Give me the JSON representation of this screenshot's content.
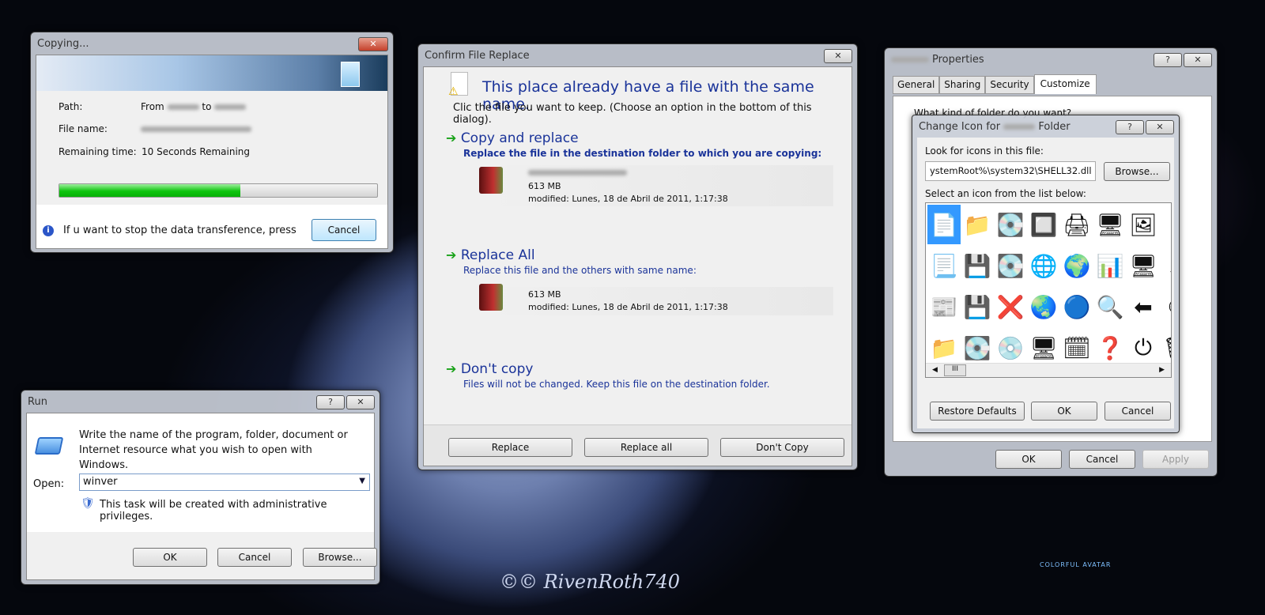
{
  "copying": {
    "title": "Copying...",
    "path_label": "Path:",
    "path_from": "From",
    "path_to": "to",
    "file_label": "File name:",
    "time_label": "Remaining time:",
    "time_value": "10 Seconds Remaining",
    "progress_percent": 57,
    "footer_text": "If u want to stop the data transference, press",
    "cancel": "Cancel"
  },
  "run": {
    "title": "Run",
    "help": "?",
    "description": "Write the name of the program, folder, document or Internet resource what you wish to open with Windows.",
    "open_label": "Open:",
    "open_value": "winver",
    "admin_note": "This task will be created with administrative privileges.",
    "ok": "OK",
    "cancel": "Cancel",
    "browse": "Browse..."
  },
  "replace": {
    "title": "Confirm File Replace",
    "heading": "This place already have a file with the same name.",
    "subheading": "Clic the file you want to keep. (Choose an option in the bottom of this dialog).",
    "options": [
      {
        "title": "Copy and replace",
        "desc": "Replace the file in the destination folder to which you are copying:",
        "size": "613 MB",
        "modified": "modified: Lunes, 18 de Abril de 2011, 1:17:38"
      },
      {
        "title": "Replace All",
        "desc": "Replace this file and the others with same name:",
        "size": "613 MB",
        "modified": "modified: Lunes, 18 de Abril de 2011, 1:17:38"
      },
      {
        "title": "Don't copy",
        "desc": "Files will not be changed. Keep this file on the destination folder."
      }
    ],
    "buttons": {
      "replace": "Replace",
      "replace_all": "Replace all",
      "dont_copy": "Don't Copy"
    }
  },
  "properties": {
    "title": "Properties",
    "help": "?",
    "tabs": [
      "General",
      "Sharing",
      "Security",
      "Customize"
    ],
    "active_tab": "Customize",
    "question": "What kind of folder do you want?",
    "ok": "OK",
    "cancel": "Cancel",
    "apply": "Apply"
  },
  "change_icon": {
    "title_prefix": "Change Icon for",
    "title_suffix": "Folder",
    "help": "?",
    "look_label": "Look for icons in this file:",
    "file_value": "ystemRoot%\\system32\\SHELL32.dll",
    "browse": "Browse...",
    "select_label": "Select an icon from the list below:",
    "restore": "Restore Defaults",
    "ok": "OK",
    "cancel": "Cancel",
    "icons": [
      "📄",
      "📁",
      "💽",
      "🔲",
      "🖨",
      "🖥",
      "🖼",
      "▪",
      "📃",
      "💾",
      "💽",
      "🌐",
      "🌍",
      "📊",
      "🖥",
      "↗",
      "📰",
      "💾",
      "❌",
      "🌏",
      "🔵",
      "🔍",
      "⬅",
      "⏱",
      "📁",
      "💽",
      "💿",
      "🖥",
      "🗓",
      "❓",
      "⏻",
      "🗑"
    ]
  },
  "watermark": {
    "signature": "©© RivenRoth740",
    "logo": "COLORFUL AVATAR"
  }
}
